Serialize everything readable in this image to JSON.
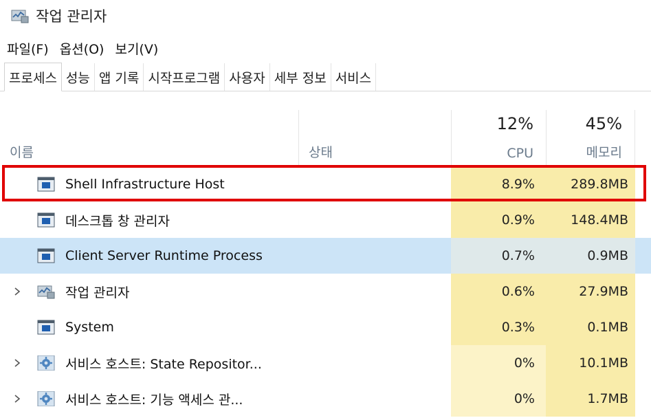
{
  "window": {
    "title": "작업 관리자"
  },
  "menu": [
    "파일(F)",
    "옵션(O)",
    "보기(V)"
  ],
  "tabs": [
    "프로세스",
    "성능",
    "앱 기록",
    "시작프로그램",
    "사용자",
    "세부 정보",
    "서비스"
  ],
  "columns": {
    "name": "이름",
    "status": "상태",
    "cpu": {
      "percent": "12%",
      "label": "CPU"
    },
    "memory": {
      "percent": "45%",
      "label": "메모리"
    }
  },
  "rows": [
    {
      "name": "Shell Infrastructure Host",
      "cpu": "8.9%",
      "memory": "289.8MB",
      "icon": "window-app-icon",
      "expandable": false,
      "selected": false
    },
    {
      "name": "데스크톱 창 관리자",
      "cpu": "0.9%",
      "memory": "148.4MB",
      "icon": "window-app-icon",
      "expandable": false,
      "selected": false
    },
    {
      "name": "Client Server Runtime Process",
      "cpu": "0.7%",
      "memory": "0.9MB",
      "icon": "window-app-icon",
      "expandable": false,
      "selected": true
    },
    {
      "name": "작업 관리자",
      "cpu": "0.6%",
      "memory": "27.9MB",
      "icon": "task-manager-icon",
      "expandable": true,
      "selected": false
    },
    {
      "name": "System",
      "cpu": "0.3%",
      "memory": "0.1MB",
      "icon": "window-app-icon",
      "expandable": false,
      "selected": false
    },
    {
      "name": "서비스 호스트: State Repositor...",
      "cpu": "0%",
      "memory": "10.1MB",
      "icon": "service-gear-icon",
      "expandable": true,
      "selected": false
    },
    {
      "name": "서비스 호스트: 기능 액세스 관...",
      "cpu": "0%",
      "memory": "1.7MB",
      "icon": "service-gear-icon",
      "expandable": true,
      "selected": false
    }
  ],
  "colors": {
    "selected_row": "#cce4f7",
    "heat_strong": "#f9ecaa",
    "heat_light": "#fcf3c8",
    "highlight_outline": "#e00000"
  }
}
